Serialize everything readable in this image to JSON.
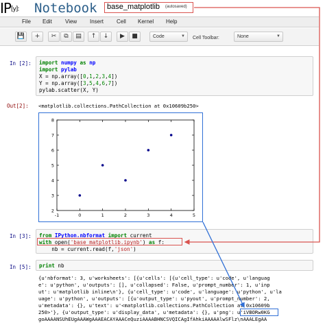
{
  "header": {
    "logo_main": "IP",
    "logo_sub": "[y]:",
    "app_name": "Notebook",
    "notebook_name": "base_matplotlib",
    "save_status": "(autosaved)"
  },
  "menubar": {
    "items": [
      "File",
      "Edit",
      "View",
      "Insert",
      "Cell",
      "Kernel",
      "Help"
    ]
  },
  "toolbar": {
    "buttons": [
      {
        "icon": "save-icon",
        "glyph": "💾"
      },
      {
        "icon": "add-cell-icon",
        "glyph": "+"
      },
      {
        "icon": "cut-icon",
        "glyph": "✂"
      },
      {
        "icon": "copy-icon",
        "glyph": "⧉"
      },
      {
        "icon": "paste-icon",
        "glyph": "▤"
      },
      {
        "icon": "move-up-icon",
        "glyph": "↑"
      },
      {
        "icon": "move-down-icon",
        "glyph": "↓"
      },
      {
        "icon": "run-icon",
        "glyph": "▶"
      },
      {
        "icon": "stop-icon",
        "glyph": "■"
      }
    ],
    "cell_type_value": "Code",
    "cell_toolbar_label": "Cell Toolbar:",
    "cell_toolbar_value": "None"
  },
  "cells": {
    "in2_prompt": "In [2]:",
    "in2_lines": [
      "import numpy as np",
      "import pylab",
      "X = np.array([0,1,2,3,4])",
      "Y = np.array([3,5,4,6,7])",
      "pylab.scatter(X, Y)"
    ],
    "out2_prompt": "Out[2]:",
    "out2_text": "<matplotlib.collections.PathCollection at 0x10609b250>",
    "in3_prompt": "In [3]:",
    "in3_lines": [
      "from IPython.nbformat import current",
      "with open('base_matplotlib.ipynb') as f:",
      "    nb = current.read(f,'json')"
    ],
    "in5_prompt": "In [5]:",
    "in5_lines": [
      "print nb"
    ],
    "out5_lines": [
      "{u'nbformat': 3, u'worksheets': [{u'cells': [{u'cell_type': u'code', u'languag",
      "e': u'python', u'outputs': [], u'collapsed': False, u'prompt_number': 1, u'inp",
      "ut': u'matplotlib inline\\n'}, {u'cell_type': u'code', u'language': u'python', u'la",
      "uage': u'python', u'outputs': [{u'output_type': u'pyout', u'prompt_number': 2,",
      "u'metadata': {}, u'text': u'<matplotlib.collections.PathCollection at 0x10609b",
      "250>'}, {u'output_type': u'display_data', u'metadata': {}, u'png': u'iVBORw0KG",
      "goAAAANSUhEUgAAAWgAAAEACAYAAACeQuziAAAABHNCSVQICAgIfAhkiAAAAAlwSFlz\\nAAALEgAA"
    ]
  },
  "chart_data": {
    "type": "scatter",
    "x": [
      0,
      1,
      2,
      3,
      4
    ],
    "y": [
      3,
      5,
      4,
      6,
      7
    ],
    "xlim": [
      -1,
      5
    ],
    "ylim": [
      2,
      8
    ],
    "xticks": [
      "-1",
      "0",
      "1",
      "2",
      "3",
      "4",
      "5"
    ],
    "yticks": [
      "2",
      "3",
      "4",
      "5",
      "6",
      "7",
      "8"
    ],
    "marker_color": "#00008b",
    "title": "",
    "xlabel": "",
    "ylabel": ""
  },
  "colors": {
    "highlight": "#d9534f",
    "arrow_blue": "#2f6fd6",
    "prompt_in": "#000080",
    "prompt_out": "#8b0000"
  }
}
